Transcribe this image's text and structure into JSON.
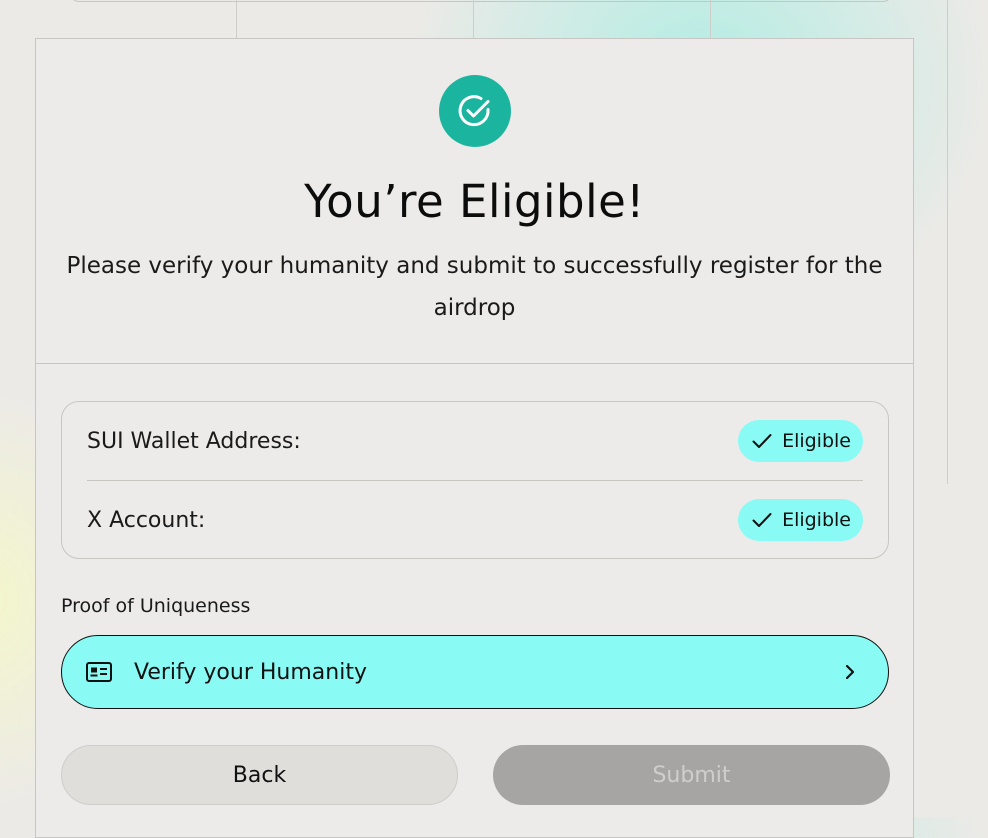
{
  "header": {
    "title": "You’re Eligible!",
    "subtitle": "Please verify your humanity and submit to successfully register for the airdrop"
  },
  "eligibility": {
    "rows": [
      {
        "label": "SUI Wallet Address:",
        "status": "Eligible"
      },
      {
        "label": "X Account:",
        "status": "Eligible"
      }
    ]
  },
  "proof": {
    "section_label": "Proof of Uniqueness",
    "verify_label": "Verify your Humanity"
  },
  "actions": {
    "back_label": "Back",
    "submit_label": "Submit"
  },
  "colors": {
    "accent_teal": "#1bb59f",
    "pill_cyan": "#8afaf4",
    "submit_disabled": "#a6a5a3"
  },
  "icons": {
    "badge": "check-circle-icon",
    "pill": "check-icon",
    "verify": "id-card-icon",
    "chevron": "chevron-right-icon"
  }
}
